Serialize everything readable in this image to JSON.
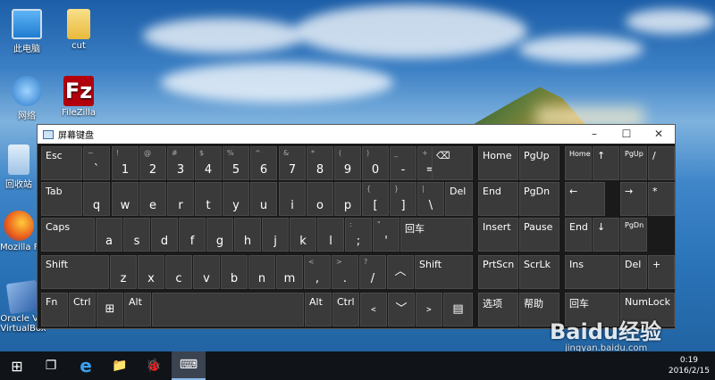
{
  "desktop": {
    "icons": [
      {
        "label": "此电脑",
        "name": "this-pc-icon"
      },
      {
        "label": "cut",
        "name": "folder-icon"
      },
      {
        "label": "网络",
        "name": "network-icon"
      },
      {
        "label": "FileZilla",
        "name": "filezilla-icon"
      },
      {
        "label": "回收站",
        "name": "recycle-bin-icon"
      },
      {
        "label": "Mozilla Firefox",
        "name": "firefox-icon"
      },
      {
        "label": "Oracle VM VirtualBox",
        "name": "virtualbox-icon"
      }
    ]
  },
  "osk": {
    "title": "屏幕键盘",
    "controls": {
      "minimize": "–",
      "maximize": "☐",
      "close": "✕"
    }
  },
  "keys": {
    "esc": "Esc",
    "backtick_s": "~",
    "backtick_m": "`",
    "n1s": "!",
    "n1": "1",
    "n2s": "@",
    "n2": "2",
    "n3s": "#",
    "n3": "3",
    "n4s": "$",
    "n4": "4",
    "n5s": "%",
    "n5": "5",
    "n6s": "^",
    "n6": "6",
    "n7s": "&",
    "n7": "7",
    "n8s": "*",
    "n8": "8",
    "n9s": "(",
    "n9": "9",
    "n0s": ")",
    "n0": "0",
    "minus_s": "_",
    "minus": "-",
    "eq_s": "+",
    "eq": "=",
    "bksp": "⌫",
    "tab": "Tab",
    "q": "q",
    "w": "w",
    "e": "e",
    "r": "r",
    "t": "t",
    "y": "y",
    "u": "u",
    "i": "i",
    "o": "o",
    "p": "p",
    "lbr_s": "{",
    "lbr": "[",
    "rbr_s": "}",
    "rbr": "]",
    "bsl_s": "|",
    "bsl": "\\",
    "del": "Del",
    "caps": "Caps",
    "a": "a",
    "s": "s",
    "d": "d",
    "f": "f",
    "g": "g",
    "h": "h",
    "j": "j",
    "k": "k",
    "l": "l",
    "semi_s": ":",
    "semi": ";",
    "quote_s": "\"",
    "quote": "'",
    "enter": "回车",
    "shift": "Shift",
    "z": "z",
    "x": "x",
    "c": "c",
    "v": "v",
    "b": "b",
    "n": "n",
    "m": "m",
    "comma_s": "<",
    "comma": ",",
    "dot_s": ">",
    "dot": ".",
    "slash_s": "?",
    "slash": "/",
    "up": "︿",
    "rshift": "Shift",
    "fn": "Fn",
    "ctrl": "Ctrl",
    "win": "⊞",
    "alt": "Alt",
    "ralt": "Alt",
    "rctrl": "Ctrl",
    "left": "﹤",
    "down": "﹀",
    "right": "﹥",
    "menu": "▤",
    "home": "Home",
    "pgup": "PgUp",
    "end": "End",
    "pgdn": "PgDn",
    "insert": "Insert",
    "pause": "Pause",
    "prtscn": "PrtScn",
    "scrlk": "ScrLk",
    "options": "选项",
    "help": "帮助",
    "np_home": "Home",
    "np_up": "↑",
    "np_pgup": "PgUp",
    "np_div": "/",
    "np_left": "←",
    "np_right": "→",
    "np_mul": "*",
    "np_end": "End",
    "np_down": "↓",
    "np_pgdn": "PgDn",
    "np_ins": "Ins",
    "np_del": "Del",
    "np_plus": "+",
    "np_enter": "回车",
    "numlock": "NumLock"
  },
  "taskbar": {
    "start": "⊞",
    "taskview": "❐",
    "ie": "e",
    "explorer": "📁",
    "app": "🐞",
    "osk": "⌨",
    "time": "0:19",
    "date": "2016/2/15"
  },
  "watermark": {
    "brand": "Baidu经验",
    "url": "jingyan.baidu.com"
  }
}
